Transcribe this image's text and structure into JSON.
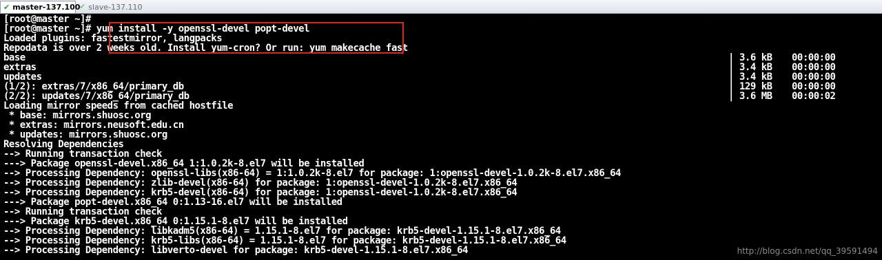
{
  "tabs": [
    {
      "label": "master-137.100",
      "active": true,
      "icon": "check-icon"
    },
    {
      "label": "slave-137.110",
      "active": false,
      "icon": "check-icon"
    }
  ],
  "terminal": {
    "lines": [
      "[root@master ~]#",
      "[root@master ~]# yum install -y openssl-devel popt-devel",
      "Loaded plugins: fastestmirror, langpacks",
      "Repodata is over 2 weeks old. Install yum-cron? Or run: yum makecache fast",
      "base",
      "extras",
      "updates",
      "(1/2): extras/7/x86_64/primary_db",
      "(2/2): updates/7/x86_64/primary_db",
      "Loading mirror speeds from cached hostfile",
      " * base: mirrors.shuosc.org",
      " * extras: mirrors.neusoft.edu.cn",
      " * updates: mirrors.shuosc.org",
      "Resolving Dependencies",
      "--> Running transaction check",
      "---> Package openssl-devel.x86_64 1:1.0.2k-8.el7 will be installed",
      "--> Processing Dependency: openssl-libs(x86-64) = 1:1.0.2k-8.el7 for package: 1:openssl-devel-1.0.2k-8.el7.x86_64",
      "--> Processing Dependency: zlib-devel(x86-64) for package: 1:openssl-devel-1.0.2k-8.el7.x86_64",
      "--> Processing Dependency: krb5-devel(x86-64) for package: 1:openssl-devel-1.0.2k-8.el7.x86_64",
      "---> Package popt-devel.x86_64 0:1.13-16.el7 will be installed",
      "--> Running transaction check",
      "---> Package krb5-devel.x86_64 0:1.15.1-8.el7 will be installed",
      "--> Processing Dependency: libkadm5(x86-64) = 1.15.1-8.el7 for package: krb5-devel-1.15.1-8.el7.x86_64",
      "--> Processing Dependency: krb5-libs(x86-64) = 1.15.1-8.el7 for package: krb5-devel-1.15.1-8.el7.x86_64",
      "--> Processing Dependency: libverto-devel for package: krb5-devel-1.15.1-8.el7.x86_64"
    ],
    "download_stats": [
      {
        "bar": "|",
        "size": "3.6 kB",
        "time": "00:00:00"
      },
      {
        "bar": "|",
        "size": "3.4 kB",
        "time": "00:00:00"
      },
      {
        "bar": "|",
        "size": "3.4 kB",
        "time": "00:00:00"
      },
      {
        "bar": "|",
        "size": "129 kB",
        "time": "00:00:00"
      },
      {
        "bar": "|",
        "size": "3.6 MB",
        "time": "00:00:02"
      }
    ],
    "text_color": "#ffffff",
    "background_color": "#000000"
  },
  "annotation": {
    "highlight_color": "#e0241b"
  },
  "watermark": "http://blog.csdn.net/qq_39591494"
}
